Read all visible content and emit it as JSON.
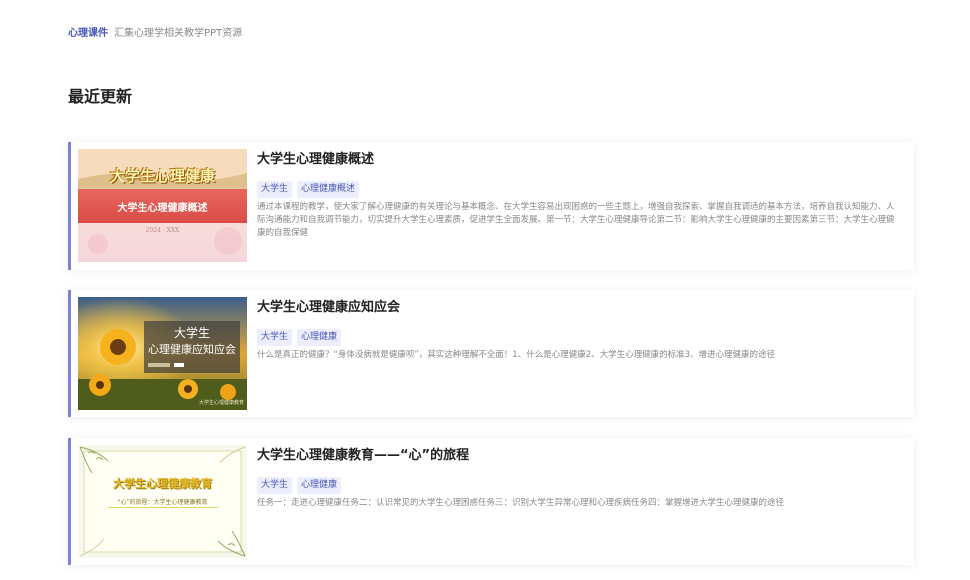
{
  "topbar": {
    "brand": "心理课件",
    "tagline": "汇集心理学相关教学PPT资源"
  },
  "section_title": "最近更新",
  "courses": [
    {
      "title": "大学生心理健康概述",
      "tags": [
        "大学生",
        "心理健康概述"
      ],
      "description": "通过本课程的教学，使大家了解心理健康的有关理论与基本概念、在大学生容易出现困惑的一些主题上，增强自我探索、掌握自我调适的基本方法，培养自我认知能力、人际沟通能力和自我调节能力，切实提升大学生心理素质，促进学生全面发展。第一节：大学生心理健康导论第二节：影响大学生心理健康的主要因素第三节：大学生心理健康的自我保健",
      "thumb": {
        "heading": "大学生心理健康",
        "subtitle": "大学生心理健康概述",
        "footer": "2024 · XXX"
      }
    },
    {
      "title": "大学生心理健康应知应会",
      "tags": [
        "大学生",
        "心理健康"
      ],
      "description": "什么是真正的健康？“身体没病就是健康呗”，其实这种理解不全面！1、什么是心理健康2、大学生心理健康的标准3、增进心理健康的途径",
      "thumb": {
        "line1": "大学生",
        "line2": "心理健康应知应会",
        "footer": "大学生心理健康教育"
      }
    },
    {
      "title": "大学生心理健康教育——“心”的旅程",
      "tags": [
        "大学生",
        "心理健康"
      ],
      "description": "任务一：走进心理健康任务二：认识常见的大学生心理困惑任务三：识别大学生异常心理和心理疾病任务四：掌握增进大学生心理健康的途径",
      "thumb": {
        "heading": "大学生心理健康教育",
        "subtitle": "“心”的旅程：大学生心理健康教育"
      }
    }
  ],
  "colors": {
    "accent": "#4a56b8",
    "card_border": "#7b82d8",
    "tag_bg": "#eceefb"
  }
}
